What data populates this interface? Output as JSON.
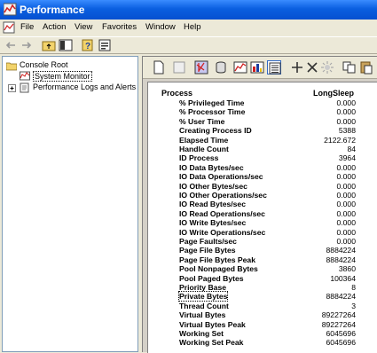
{
  "window": {
    "title": "Performance"
  },
  "menu": [
    "File",
    "Action",
    "View",
    "Favorites",
    "Window",
    "Help"
  ],
  "tree": {
    "root": "Console Root",
    "children": [
      "System Monitor",
      "Performance Logs and Alerts"
    ]
  },
  "report": {
    "object_header": "Process",
    "instance_header": "LongSleep",
    "counters": [
      {
        "name": "% Privileged Time",
        "value": "0.000"
      },
      {
        "name": "% Processor Time",
        "value": "0.000"
      },
      {
        "name": "% User Time",
        "value": "0.000"
      },
      {
        "name": "Creating Process ID",
        "value": "5388"
      },
      {
        "name": "Elapsed Time",
        "value": "2122.672"
      },
      {
        "name": "Handle Count",
        "value": "84"
      },
      {
        "name": "ID Process",
        "value": "3964"
      },
      {
        "name": "IO Data Bytes/sec",
        "value": "0.000"
      },
      {
        "name": "IO Data Operations/sec",
        "value": "0.000"
      },
      {
        "name": "IO Other Bytes/sec",
        "value": "0.000"
      },
      {
        "name": "IO Other Operations/sec",
        "value": "0.000"
      },
      {
        "name": "IO Read Bytes/sec",
        "value": "0.000"
      },
      {
        "name": "IO Read Operations/sec",
        "value": "0.000"
      },
      {
        "name": "IO Write Bytes/sec",
        "value": "0.000"
      },
      {
        "name": "IO Write Operations/sec",
        "value": "0.000"
      },
      {
        "name": "Page Faults/sec",
        "value": "0.000"
      },
      {
        "name": "Page File Bytes",
        "value": "8884224"
      },
      {
        "name": "Page File Bytes Peak",
        "value": "8884224"
      },
      {
        "name": "Pool Nonpaged Bytes",
        "value": "3860"
      },
      {
        "name": "Pool Paged Bytes",
        "value": "100364"
      },
      {
        "name": "Priority Base",
        "value": "8"
      },
      {
        "name": "Private Bytes",
        "value": "8884224"
      },
      {
        "name": "Thread Count",
        "value": "3"
      },
      {
        "name": "Virtual Bytes",
        "value": "89227264"
      },
      {
        "name": "Virtual Bytes Peak",
        "value": "89227264"
      },
      {
        "name": "Working Set",
        "value": "6045696"
      },
      {
        "name": "Working Set Peak",
        "value": "6045696"
      }
    ]
  }
}
